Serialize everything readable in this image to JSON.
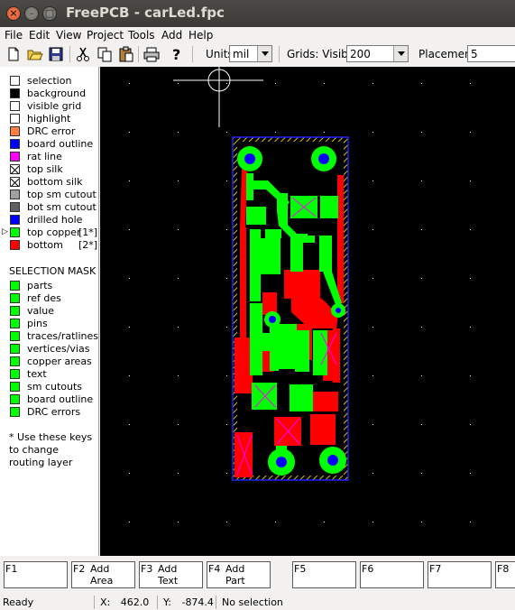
{
  "window": {
    "title": "FreePCB - carLed.fpc"
  },
  "menu": [
    "File",
    "Edit",
    "View",
    "Project",
    "Tools",
    "Add",
    "Help"
  ],
  "toolbar": {
    "units_label": "Units",
    "units_value": "mil",
    "grids_label": "Grids: Visible",
    "grids_value": "200",
    "placement_label": "Placement",
    "placement_value": "5"
  },
  "layers": [
    {
      "label": "selection",
      "color": "#ffffff"
    },
    {
      "label": "background",
      "color": "#000000"
    },
    {
      "label": "visible grid",
      "color": "#ffffff"
    },
    {
      "label": "highlight",
      "color": "#ffffff"
    },
    {
      "label": "DRC error",
      "color": "#ff8040"
    },
    {
      "label": "board outline",
      "color": "#0000ff"
    },
    {
      "label": "rat line",
      "color": "#ff00ff"
    },
    {
      "label": "top silk",
      "color": "#ffffff",
      "cross": true
    },
    {
      "label": "bottom silk",
      "color": "#ffffff",
      "cross": true
    },
    {
      "label": "top sm cutout",
      "color": "#a0a0a0"
    },
    {
      "label": "bot sm cutout",
      "color": "#606060"
    },
    {
      "label": "drilled hole",
      "color": "#0000ff"
    },
    {
      "label": "top copper",
      "color": "#00ff00",
      "key": "[1*]",
      "active": true
    },
    {
      "label": "bottom",
      "color": "#ff0000",
      "key": "[2*]"
    }
  ],
  "selection_mask": {
    "title": "SELECTION MASK",
    "items": [
      "parts",
      "ref des",
      "value",
      "pins",
      "traces/ratlines",
      "vertices/vias",
      "copper areas",
      "text",
      "sm cutouts",
      "board outline",
      "DRC errors"
    ],
    "color": "#00ff00"
  },
  "note": "* Use these keys to change routing layer",
  "fkeys": [
    {
      "key": "F1",
      "line1": "",
      "line2": ""
    },
    {
      "key": "F2",
      "line1": "Add",
      "line2": "Area"
    },
    {
      "key": "F3",
      "line1": "Add",
      "line2": "Text"
    },
    {
      "key": "F4",
      "line1": "Add",
      "line2": "Part"
    },
    {
      "key": "F5",
      "line1": "",
      "line2": ""
    },
    {
      "key": "F6",
      "line1": "",
      "line2": ""
    },
    {
      "key": "F7",
      "line1": "",
      "line2": ""
    },
    {
      "key": "F8",
      "line1": "",
      "line2": ""
    }
  ],
  "status": {
    "ready": "Ready",
    "x_label": "X:",
    "x_value": "462.0",
    "y_label": "Y:",
    "y_value": "-874.4",
    "selection": "No selection"
  }
}
